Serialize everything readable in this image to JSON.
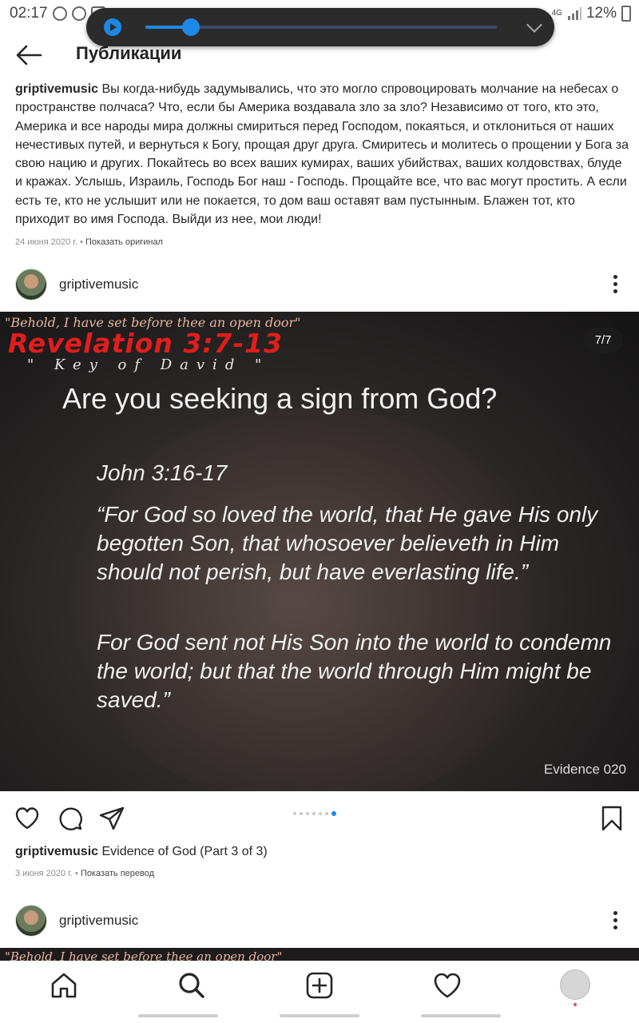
{
  "status_bar": {
    "time": "02:17",
    "network": "4G",
    "battery": "12%"
  },
  "media_player": {
    "progress": 0.13,
    "accent": "#1e88e5"
  },
  "header": {
    "back_icon": "arrow-left-icon",
    "title": "Публикации"
  },
  "previous_post": {
    "username": "griptivemusic",
    "caption": "Вы когда-нибудь задумывались, что это могло спровоцировать молчание на небесах о пространстве полчаса? Что, если бы Америка воздавала зло за зло? Независимо от того, кто это, Америка и все народы мира должны смириться перед Господом, покаяться, и отклониться от наших нечестивых путей, и вернуться к Богу, прощая друг друга. Смиритесь и молитесь о прощении у Бога за свою нацию и других. Покайтесь во всех ваших кумирах, ваших убийствах, ваших колдовствах, блуде и кражах. Услышь, Израиль, Господь Бог наш - Господь. Прощайте все, что вас могут простить. А если есть те, кто не услышит или не покается, то дом ваш оставят вам пустынным. Блажен тот, кто приходит во имя Господа. Выйди из нее, мои люди!",
    "date": "24 июня 2020 г.",
    "separator": "•",
    "action_link": "Показать оригинал"
  },
  "post": {
    "username": "griptivemusic",
    "more_icon": "more-vertical-icon",
    "image": {
      "counter": "7/7",
      "kicker": "\"Behold, I have set before thee an open door\"",
      "revelation": "Revelation 3:7-13",
      "key_of_david": "\" Key of David \"",
      "heading": "Are you seeking a sign from God?",
      "reference": "John 3:16-17",
      "quote1": "“For God so loved the world, that He gave His only begotten Son, that whosoever believeth in Him should not perish, but have everlasting life.”",
      "quote2": "For God sent not His Son into the world to condemn the world; but that the world through Him might be saved.”",
      "evidence": "Evidence 020"
    },
    "carousel": {
      "count": 7,
      "active_index": 7
    },
    "actions": {
      "like_icon": "heart-icon",
      "comment_icon": "comment-icon",
      "share_icon": "send-icon",
      "save_icon": "bookmark-icon"
    },
    "caption_text": "Evidence of God (Part 3 of 3)",
    "date": "3 июня 2020 г.",
    "separator": "•",
    "action_link": "Показать перевод"
  },
  "next_post": {
    "username": "griptivemusic",
    "kicker": "\"Behold, I have set before thee an open door\""
  },
  "bottom_nav": {
    "items": [
      "home-icon",
      "search-icon",
      "add-post-icon",
      "activity-heart-icon",
      "profile-icon"
    ],
    "notification_color": "#ed4956"
  }
}
